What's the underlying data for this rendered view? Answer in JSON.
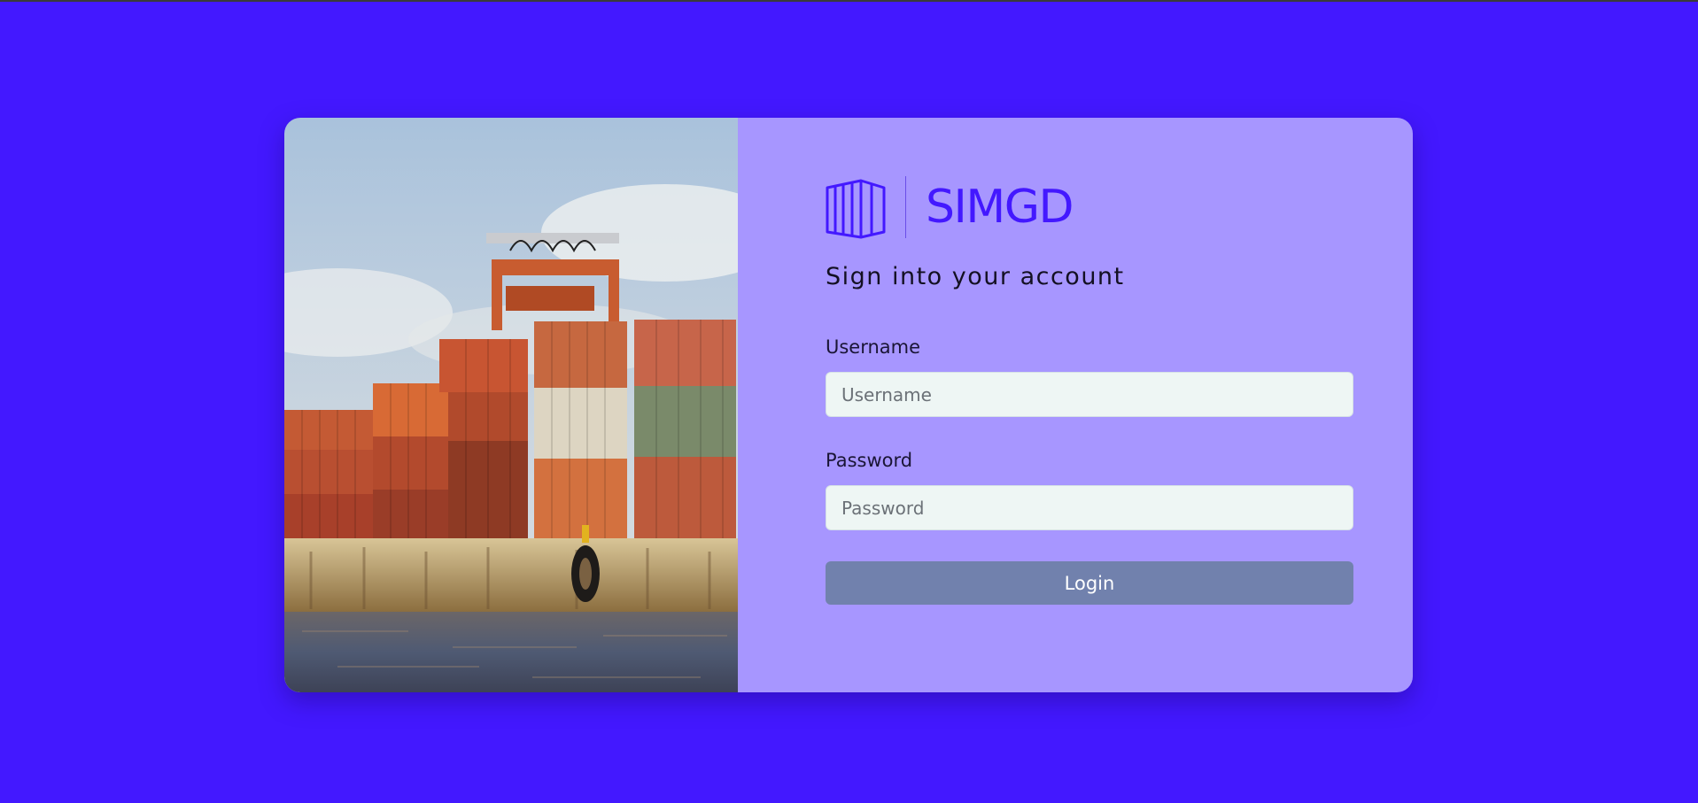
{
  "brand": {
    "name": "SIMGD",
    "logo_icon": "shipping-container-icon",
    "color": "#4318ff"
  },
  "heading": "Sign into your account",
  "form": {
    "username_label": "Username",
    "username_placeholder": "Username",
    "username_value": "",
    "password_label": "Password",
    "password_placeholder": "Password",
    "password_value": "",
    "login_label": "Login"
  },
  "colors": {
    "page_background": "#4318ff",
    "panel_background": "#a796ff",
    "input_background": "#eef6f4",
    "button_background": "#7181ad"
  }
}
